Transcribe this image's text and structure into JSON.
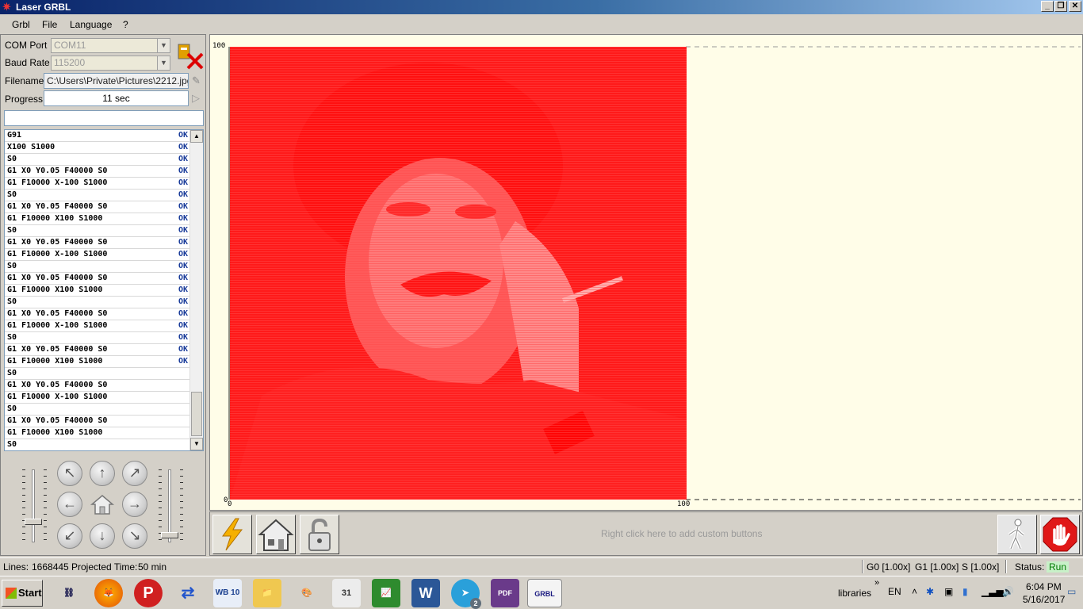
{
  "window": {
    "title": "Laser GRBL"
  },
  "menu": [
    "Grbl",
    "File",
    "Language",
    "?"
  ],
  "connection": {
    "com_label": "COM Port",
    "com_value": "COM11",
    "baud_label": "Baud Rate",
    "baud_value": "115200"
  },
  "file": {
    "label": "Filename",
    "value": "C:\\Users\\Private\\Pictures\\2212.jpg"
  },
  "progress": {
    "label": "Progress",
    "value": "11 sec"
  },
  "gcode_rows": [
    {
      "cmd": "G91",
      "status": "OK"
    },
    {
      "cmd": "X100 S1000",
      "status": "OK"
    },
    {
      "cmd": "S0",
      "status": "OK"
    },
    {
      "cmd": "G1 X0 Y0.05 F40000 S0",
      "status": "OK"
    },
    {
      "cmd": "G1 F10000 X-100 S1000",
      "status": "OK"
    },
    {
      "cmd": "S0",
      "status": "OK"
    },
    {
      "cmd": "G1 X0 Y0.05 F40000 S0",
      "status": "OK"
    },
    {
      "cmd": "G1 F10000 X100 S1000",
      "status": "OK"
    },
    {
      "cmd": "S0",
      "status": "OK"
    },
    {
      "cmd": "G1 X0 Y0.05 F40000 S0",
      "status": "OK"
    },
    {
      "cmd": "G1 F10000 X-100 S1000",
      "status": "OK"
    },
    {
      "cmd": "S0",
      "status": "OK"
    },
    {
      "cmd": "G1 X0 Y0.05 F40000 S0",
      "status": "OK"
    },
    {
      "cmd": "G1 F10000 X100 S1000",
      "status": "OK"
    },
    {
      "cmd": "S0",
      "status": "OK"
    },
    {
      "cmd": "G1 X0 Y0.05 F40000 S0",
      "status": "OK"
    },
    {
      "cmd": "G1 F10000 X-100 S1000",
      "status": "OK"
    },
    {
      "cmd": "S0",
      "status": "OK"
    },
    {
      "cmd": "G1 X0 Y0.05 F40000 S0",
      "status": "OK"
    },
    {
      "cmd": "G1 F10000 X100 S1000",
      "status": "OK"
    },
    {
      "cmd": "S0",
      "status": ""
    },
    {
      "cmd": "G1 X0 Y0.05 F40000 S0",
      "status": ""
    },
    {
      "cmd": "G1 F10000 X-100 S1000",
      "status": ""
    },
    {
      "cmd": "S0",
      "status": ""
    },
    {
      "cmd": "G1 X0 Y0.05 F40000 S0",
      "status": ""
    },
    {
      "cmd": "G1 F10000 X100 S1000",
      "status": ""
    },
    {
      "cmd": "S0",
      "status": ""
    }
  ],
  "canvas": {
    "x_min": "0",
    "x_max": "100",
    "y_min": "0",
    "y_max": "100"
  },
  "custom_buttons_hint": "Right click here to add custom buttons",
  "status": {
    "lines_label": "Lines:",
    "lines_value": "1668445",
    "projected_label": "Projected Time:",
    "projected_value": "50 min",
    "g0": "G0 [1.00x]",
    "g1": "G1 [1.00x]",
    "s": "S [1.00x]",
    "state_label": "Status:",
    "state_value": "Run"
  },
  "taskbar": {
    "start": "Start",
    "tray_text": "libraries",
    "tray_chevron": "»",
    "lang": "EN",
    "time": "6:04 PM",
    "date": "5/16/2017",
    "apps": [
      "network",
      "firefox",
      "p-app",
      "sync",
      "wb10",
      "explorer",
      "paint",
      "calendar",
      "chart",
      "word",
      "telegram",
      "pdf",
      "grbl"
    ],
    "telegram_badge": "2",
    "wb_label": "WB 10",
    "pdf_label": "PDF",
    "grbl_label": "GRBL"
  },
  "colors": {
    "laser_red": "#ff1a1a",
    "canvas_bg": "#fffde8",
    "run_green": "#00aa00"
  }
}
